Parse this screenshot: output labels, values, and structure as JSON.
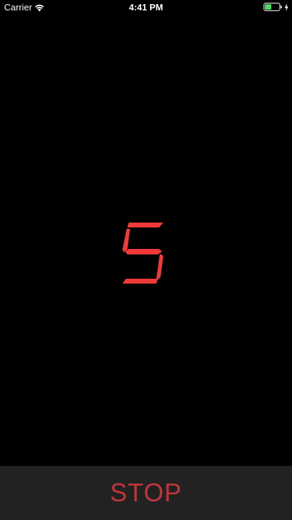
{
  "status_bar": {
    "carrier": "Carrier",
    "time": "4:41 PM",
    "battery_level": 0.45,
    "charging": true
  },
  "display": {
    "digit": "5",
    "color": "#F03A3A"
  },
  "stop_button": {
    "label": "STOP",
    "color": "#C0353A",
    "background": "#222222"
  },
  "icons": {
    "wifi": "wifi-icon",
    "battery": "battery-icon",
    "charging": "charging-bolt-icon"
  }
}
